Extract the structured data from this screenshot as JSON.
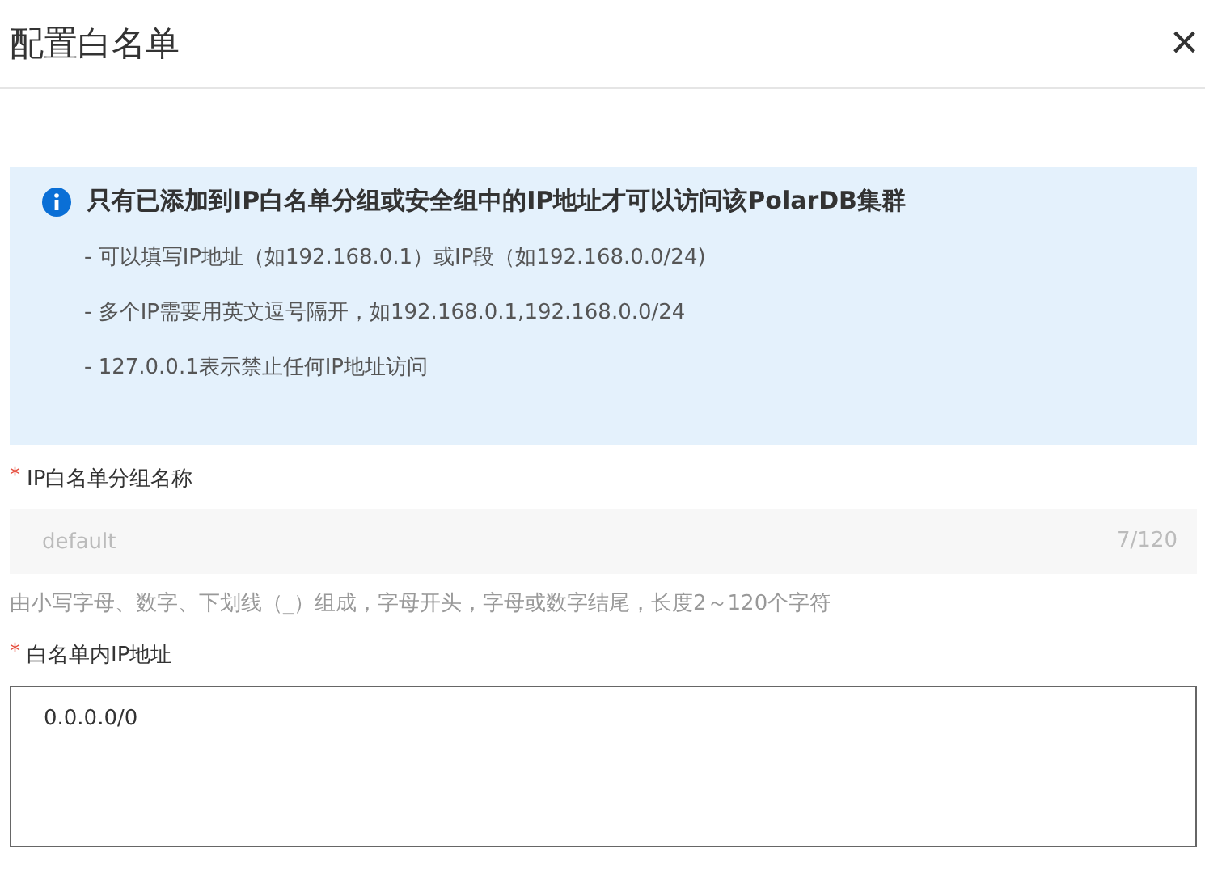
{
  "dialog": {
    "title": "配置白名单",
    "close": "×"
  },
  "notice": {
    "title": "只有已添加到IP白名单分组或安全组中的IP地址才可以访问该PolarDB集群",
    "items": [
      "- 可以填写IP地址（如192.168.0.1）或IP段（如192.168.0.0/24)",
      "- 多个IP需要用英文逗号隔开，如192.168.0.1,192.168.0.0/24",
      "- 127.0.0.1表示禁止任何IP地址访问"
    ]
  },
  "fields": [
    {
      "kind": "input",
      "required_mark": "*",
      "label": "IP白名单分组名称",
      "value": "default",
      "disabled": true,
      "counter": "7/120",
      "hint": "由小写字母、数字、下划线（_）组成，字母开头，字母或数字结尾，长度2～120个字符"
    },
    {
      "kind": "textarea",
      "required_mark": "*",
      "label": "白名单内IP地址",
      "value": "0.0.0.0/0",
      "disabled": false
    }
  ]
}
